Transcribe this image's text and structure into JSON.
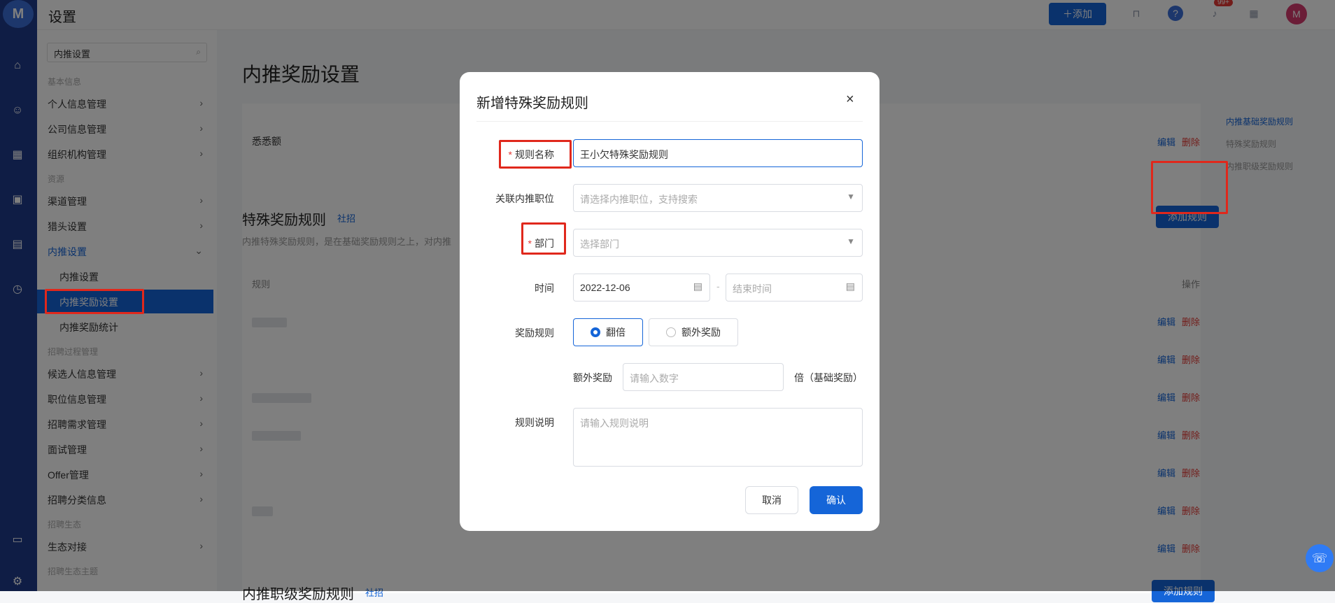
{
  "app": {
    "page_title": "设置",
    "add_label": "添加",
    "badge": "99+",
    "avatar": "M",
    "logo": "M"
  },
  "sidebar": {
    "search_value": "内推设置",
    "groups": {
      "basic": "基本信息",
      "resources": "资源",
      "recruit_process": "招聘过程管理",
      "ecosystem": "招聘生态",
      "admin": "招聘生态主题"
    },
    "items": {
      "personal": "个人信息管理",
      "company": "公司信息管理",
      "org": "组织机构管理",
      "channel": "渠道管理",
      "headhunter": "猎头设置",
      "referral": "内推设置",
      "candidate": "候选人信息管理",
      "position": "职位信息管理",
      "demand": "招聘需求管理",
      "interview": "面试管理",
      "offer": "Offer管理",
      "category": "招聘分类信息",
      "eco": "生态对接"
    },
    "sub": {
      "referral_settings": "内推设置",
      "referral_reward": "内推奖励设置",
      "referral_stats": "内推奖励统计"
    }
  },
  "main": {
    "title": "内推奖励设置",
    "first_row": "悉悉额",
    "edit": "编辑",
    "delete": "删除",
    "special_title": "特殊奖励规则",
    "special_tag": "社招",
    "special_desc": "内推特殊奖励规则，是在基础奖励规则之上，对内推",
    "add_rule": "添加规则",
    "col_rule": "规则",
    "col_op": "操作",
    "bottom_title": "内推职级奖励规则",
    "bottom_tag": "社招"
  },
  "right_nav": [
    "内推基础奖励规则",
    "特殊奖励规则",
    "内推职级奖励规则"
  ],
  "modal": {
    "title": "新增特殊奖励规则",
    "close": "×",
    "rule_name_label": "规则名称",
    "rule_name_value": "王小欠特殊奖励规则",
    "position_label": "关联内推职位",
    "position_placeholder": "请选择内推职位，支持搜索",
    "dept_label": "部门",
    "dept_placeholder": "选择部门",
    "time_label": "时间",
    "start_date": "2022-12-06",
    "time_sep": "-",
    "end_placeholder": "结束时间",
    "reward_label": "奖励规则",
    "opt_double": "翻倍",
    "opt_extra": "额外奖励",
    "extra_label": "额外奖励",
    "extra_placeholder": "请输入数字",
    "extra_suffix": "倍（基础奖励）",
    "desc_label": "规则说明",
    "desc_placeholder": "请输入规则说明",
    "cancel": "取消",
    "confirm": "确认"
  },
  "colors": {
    "primary": "#1565d8",
    "danger": "#e53935",
    "rail": "#1e3a8a",
    "highlight": "#e0281c"
  }
}
